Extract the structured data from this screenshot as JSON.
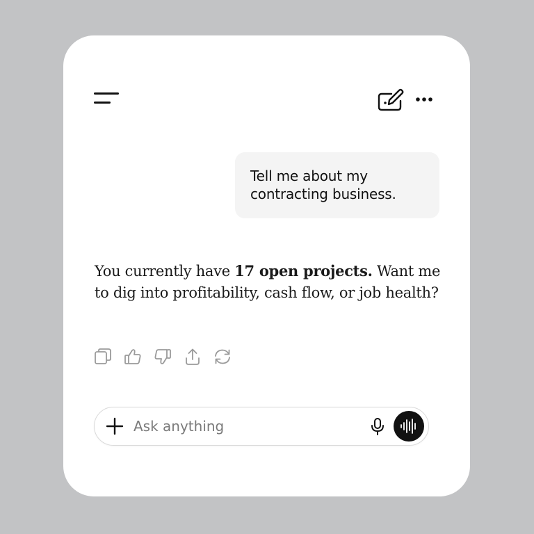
{
  "header": {
    "menu_icon": "menu-icon",
    "new_chat_icon": "edit-icon",
    "more_icon": "more-icon"
  },
  "conversation": {
    "user_message": "Tell me about my contracting business.",
    "assistant_message": {
      "before": "You currently have ",
      "bold": "17 open projects.",
      "after": " Want me to dig into profitability, cash flow, or job health?"
    }
  },
  "message_actions": [
    {
      "name": "copy",
      "icon": "copy-icon"
    },
    {
      "name": "thumbs-up",
      "icon": "thumbs-up-icon"
    },
    {
      "name": "thumbs-down",
      "icon": "thumbs-down-icon"
    },
    {
      "name": "share",
      "icon": "share-icon"
    },
    {
      "name": "regenerate",
      "icon": "refresh-icon"
    }
  ],
  "composer": {
    "placeholder": "Ask anything",
    "value": "",
    "plus_icon": "plus-icon",
    "mic_icon": "mic-icon",
    "voice_icon": "voice-waveform-icon"
  },
  "colors": {
    "background": "#c2c3c5",
    "card": "#ffffff",
    "user_bubble": "#f4f4f4",
    "voice_button": "#111111",
    "action_icons": "#9a9a9a"
  }
}
